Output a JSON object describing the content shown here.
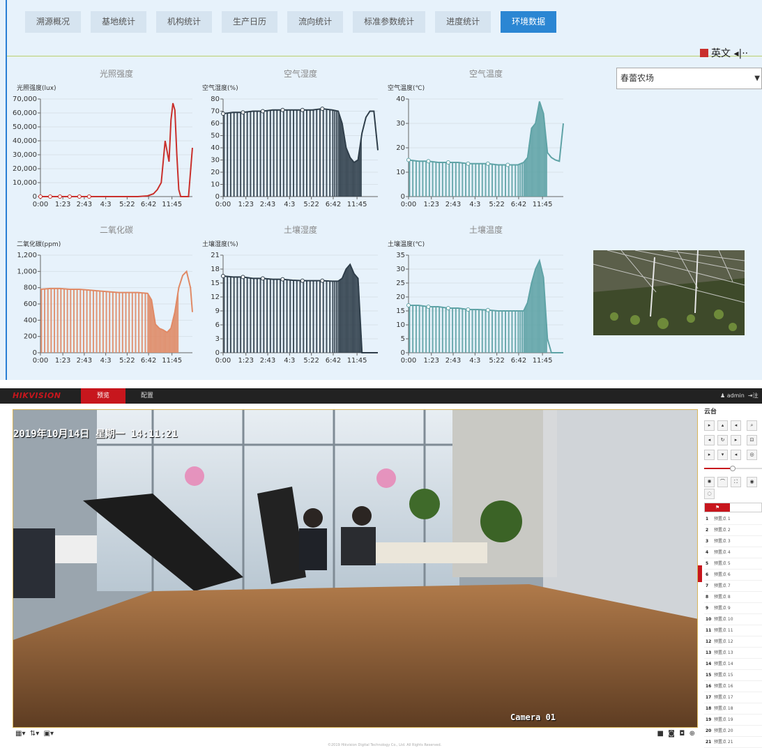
{
  "dashboard": {
    "tabs": [
      {
        "label": "溯源概况",
        "active": false
      },
      {
        "label": "基地统计",
        "active": false
      },
      {
        "label": "机构统计",
        "active": false
      },
      {
        "label": "生产日历",
        "active": false
      },
      {
        "label": "流向统计",
        "active": false
      },
      {
        "label": "标准参数统计",
        "active": false
      },
      {
        "label": "进度统计",
        "active": false
      },
      {
        "label": "环境数据",
        "active": true
      }
    ],
    "language_label": "英文",
    "farm_select": "春蕾农场",
    "accent_color": "#2b86d3"
  },
  "chart_data": [
    {
      "type": "line",
      "title": "光照强度",
      "ylabel": "光照强度(lux)",
      "color": "#c9302c",
      "ylim": [
        0,
        70000
      ],
      "yticks": [
        "0",
        "10,000",
        "20,000",
        "30,000",
        "40,000",
        "50,000",
        "60,000",
        "70,000"
      ],
      "xticks": [
        "0:00",
        "1:23",
        "2:43",
        "4:3",
        "5:22",
        "6:42",
        "11:45"
      ],
      "x": [
        0,
        0.5,
        1,
        1.5,
        2,
        2.5,
        3,
        3.5,
        4,
        4.5,
        5,
        5.5,
        5.8,
        6.0,
        6.2,
        6.4,
        6.6,
        6.7,
        6.8,
        6.9,
        7.0,
        7.1,
        7.2,
        7.3,
        7.4,
        7.6,
        7.8
      ],
      "values": [
        0,
        0,
        0,
        0,
        0,
        0,
        0,
        0,
        0,
        0,
        0,
        500,
        2000,
        5000,
        10000,
        40000,
        25000,
        55000,
        67000,
        62000,
        30000,
        5000,
        0,
        0,
        0,
        0,
        35000
      ],
      "markers": [
        0,
        1,
        2,
        3,
        4,
        5
      ]
    },
    {
      "type": "line",
      "title": "空气湿度",
      "ylabel": "空气湿度(%)",
      "color": "#2f3e4a",
      "ylim": [
        0,
        80
      ],
      "yticks": [
        "0",
        "10",
        "20",
        "30",
        "40",
        "50",
        "60",
        "70",
        "80"
      ],
      "xticks": [
        "0:00",
        "1:23",
        "2:43",
        "4:3",
        "5:22",
        "6:42",
        "11:45"
      ],
      "x": [
        0,
        0.5,
        1,
        1.5,
        2,
        2.5,
        3,
        3.5,
        4,
        4.5,
        5,
        5.5,
        5.8,
        6.0,
        6.2,
        6.4,
        6.6,
        6.8,
        7.0,
        7.2,
        7.4,
        7.6,
        7.8
      ],
      "values": [
        68,
        69,
        69,
        70,
        70,
        71,
        71,
        71,
        71,
        71,
        72,
        71,
        70,
        60,
        40,
        32,
        28,
        30,
        52,
        65,
        70,
        70,
        38
      ],
      "drops": true,
      "markers": [
        0,
        2,
        4,
        6,
        8,
        10
      ]
    },
    {
      "type": "line",
      "title": "空气温度",
      "ylabel": "空气温度(℃)",
      "color": "#5fa3a6",
      "ylim": [
        0,
        40
      ],
      "yticks": [
        "0",
        "10",
        "20",
        "30",
        "40"
      ],
      "xticks": [
        "0:00",
        "1:23",
        "2:43",
        "4:3",
        "5:22",
        "6:42",
        "11:45"
      ],
      "x": [
        0,
        0.5,
        1,
        1.5,
        2,
        2.5,
        3,
        3.5,
        4,
        4.5,
        5,
        5.5,
        5.8,
        6.0,
        6.2,
        6.4,
        6.6,
        6.8,
        7.0,
        7.2,
        7.4,
        7.6,
        7.8
      ],
      "values": [
        15,
        14.5,
        14.5,
        14,
        14,
        14,
        13.5,
        13.5,
        13.5,
        13,
        13,
        13,
        14,
        16,
        28,
        30,
        39,
        34,
        18,
        16,
        15,
        14.5,
        30
      ],
      "drops": true,
      "markers": [
        0,
        2,
        4,
        6,
        8,
        10
      ]
    },
    {
      "type": "line",
      "title": "二氧化碳",
      "ylabel": "二氧化碳(ppm)",
      "color": "#e08a66",
      "ylim": [
        0,
        1200
      ],
      "yticks": [
        "0",
        "200",
        "400",
        "600",
        "800",
        "1,000",
        "1,200"
      ],
      "xticks": [
        "0:00",
        "1:23",
        "2:43",
        "4:3",
        "5:22",
        "6:42",
        "11:45"
      ],
      "x": [
        0,
        0.5,
        1,
        1.5,
        2,
        2.5,
        3,
        3.5,
        4,
        4.5,
        5,
        5.5,
        5.7,
        5.9,
        6.1,
        6.3,
        6.5,
        6.7,
        6.9,
        7.1,
        7.3,
        7.5,
        7.7,
        7.8
      ],
      "values": [
        780,
        790,
        790,
        780,
        780,
        770,
        760,
        750,
        740,
        740,
        740,
        730,
        650,
        350,
        300,
        280,
        250,
        300,
        500,
        800,
        950,
        1000,
        800,
        500
      ],
      "drops": true,
      "markers": []
    },
    {
      "type": "line",
      "title": "土壤湿度",
      "ylabel": "土壤湿度(%)",
      "color": "#2f3e4a",
      "ylim": [
        0,
        21
      ],
      "yticks": [
        "0",
        "3",
        "6",
        "9",
        "12",
        "15",
        "18",
        "21"
      ],
      "xticks": [
        "0:00",
        "1:23",
        "2:43",
        "4:3",
        "5:22",
        "6:42",
        "11:45"
      ],
      "x": [
        0,
        0.5,
        1,
        1.5,
        2,
        2.5,
        3,
        3.5,
        4,
        4.5,
        5,
        5.5,
        5.8,
        6.0,
        6.2,
        6.4,
        6.6,
        6.8,
        7.0,
        7.2,
        7.4,
        7.6,
        7.8
      ],
      "values": [
        16.5,
        16.3,
        16.3,
        16,
        16,
        15.8,
        15.8,
        15.6,
        15.5,
        15.5,
        15.5,
        15.4,
        15.4,
        16,
        18,
        19,
        17,
        16,
        0,
        0,
        0,
        0,
        0
      ],
      "drops": true,
      "markers": [
        0,
        2,
        4,
        6,
        8,
        10
      ]
    },
    {
      "type": "line",
      "title": "土壤温度",
      "ylabel": "土壤温度(℃)",
      "color": "#5fa3a6",
      "ylim": [
        0,
        35
      ],
      "yticks": [
        "0",
        "5",
        "10",
        "15",
        "20",
        "25",
        "30",
        "35"
      ],
      "xticks": [
        "0:00",
        "1:23",
        "2:43",
        "4:3",
        "5:22",
        "6:42",
        "11:45"
      ],
      "x": [
        0,
        0.5,
        1,
        1.5,
        2,
        2.5,
        3,
        3.5,
        4,
        4.5,
        5,
        5.5,
        5.8,
        6.0,
        6.2,
        6.4,
        6.6,
        6.8,
        7.0,
        7.2,
        7.4,
        7.6,
        7.8
      ],
      "values": [
        17,
        17,
        16.5,
        16.5,
        16,
        16,
        15.5,
        15.5,
        15.3,
        15,
        15,
        15,
        15,
        18,
        25,
        30,
        33,
        27,
        5,
        0,
        0,
        0,
        0
      ],
      "drops": true,
      "markers": [
        0,
        2,
        4,
        6,
        8
      ]
    }
  ],
  "camera": {
    "logo": "HIKVISION",
    "nav_preview": "预览",
    "nav_config": "配置",
    "user": "admin",
    "logout": "注",
    "osd_time": "2019年10月14日  星期一  14:11:21",
    "osd_camera": "Camera 01",
    "copyright": "©2019 Hikvision Digital Technology Co., Ltd. All Rights Reserved.",
    "ptz_title": "云台",
    "presets": [
      "预置点 1",
      "预置点 2",
      "预置点 3",
      "预置点 4",
      "预置点 5",
      "预置点 6",
      "预置点 7",
      "预置点 8",
      "预置点 9",
      "预置点 10",
      "预置点 11",
      "预置点 12",
      "预置点 13",
      "预置点 14",
      "预置点 15",
      "预置点 16",
      "预置点 17",
      "预置点 18",
      "预置点 19",
      "预置点 20",
      "预置点 21"
    ],
    "accent_color": "#c7161d"
  }
}
